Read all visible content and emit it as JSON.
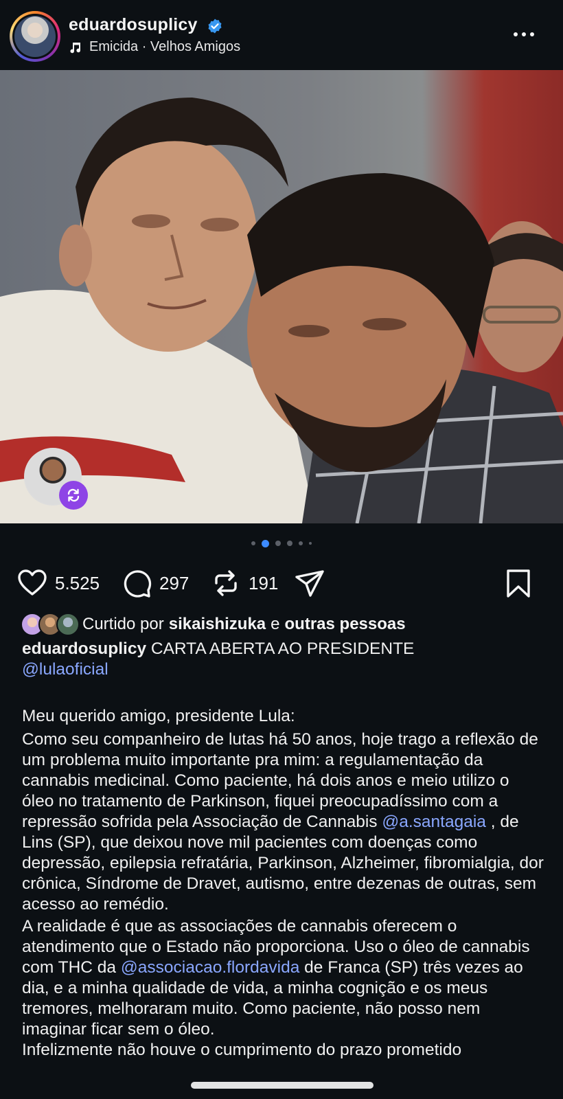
{
  "header": {
    "username": "eduardosuplicy",
    "music": "Emicida · Velhos Amigos",
    "icons": [
      "verified-badge-icon",
      "music-note-icon",
      "more-options-icon"
    ]
  },
  "carousel": {
    "total_slides": 6,
    "active_slide": 2
  },
  "actions": {
    "likes": "5.525",
    "comments": "297",
    "reposts": "191"
  },
  "liked_by": {
    "prefix": "Curtido por",
    "user": "sikaishizuka",
    "connector": "e",
    "others": "outras pessoas"
  },
  "caption": {
    "username": "eduardosuplicy",
    "title": "CARTA ABERTA AO PRESIDENTE",
    "mention_lula": "@lulaoficial",
    "greeting": "Meu querido amigo, presidente Lula:",
    "p1_a": "Como seu companheiro de lutas há 50 anos, hoje trago a reflexão de um problema muito importante pra mim: a regulamentação da cannabis medicinal. Como paciente, há dois anos e meio utilizo o óleo no tratamento de Parkinson, fiquei preocupadíssimo com a repressão sofrida pela Associação de Cannabis",
    "p1_mention": "@a.santagaia",
    "p1_b": ", de Lins (SP), que deixou nove mil pacientes com doenças como depressão, epilepsia refratária, Parkinson, Alzheimer, fibromialgia, dor crônica, Síndrome de Dravet, autismo, entre dezenas de outras, sem acesso ao remédio.",
    "p2_a": "A realidade é que as associações de cannabis oferecem o atendimento que o Estado não proporciona. Uso o óleo de cannabis com THC da",
    "p2_mention": "@associacao.flordavida",
    "p2_b": "de Franca (SP) três vezes ao dia, e a minha qualidade de vida, a minha cognição e os meus tremores, melhoraram muito. Como paciente, não posso nem imaginar ficar sem o óleo.",
    "p3": "Infelizmente não houve o cumprimento do prazo prometido"
  },
  "colors": {
    "background": "#0c1014",
    "mention": "#8aa7ff",
    "verified": "#3897f0",
    "active_dot": "#3d8bff",
    "repost_badge": "#8e44e6"
  }
}
